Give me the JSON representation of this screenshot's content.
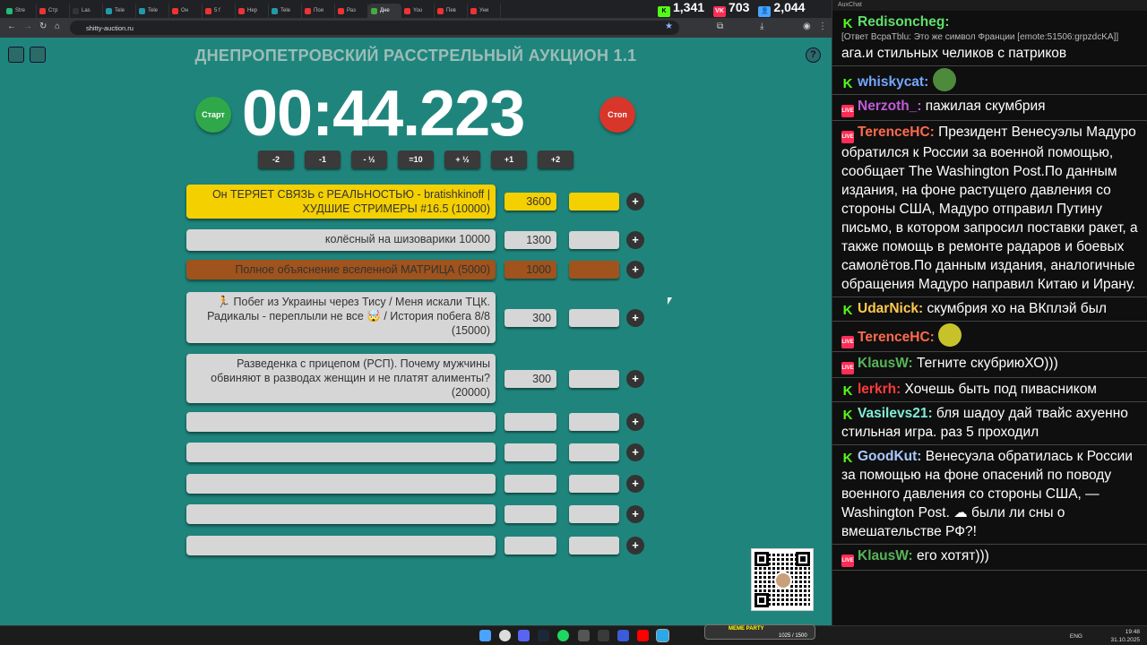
{
  "browser": {
    "tabs": [
      {
        "label": "Stre",
        "color": "#2b7"
      },
      {
        "label": "Стр",
        "color": "#e33"
      },
      {
        "label": "Las",
        "color": "#333"
      },
      {
        "label": "Tele",
        "color": "#29a"
      },
      {
        "label": "Tele",
        "color": "#29a"
      },
      {
        "label": "Он",
        "color": "#e33"
      },
      {
        "label": "5 f",
        "color": "#e33"
      },
      {
        "label": "Нер",
        "color": "#e33"
      },
      {
        "label": "Tele",
        "color": "#29a"
      },
      {
        "label": "Пои",
        "color": "#e33"
      },
      {
        "label": "Раз",
        "color": "#e33"
      },
      {
        "label": "Дне",
        "color": "#4a4"
      },
      {
        "label": "You",
        "color": "#e33"
      },
      {
        "label": "Пев",
        "color": "#e33"
      },
      {
        "label": "Уни",
        "color": "#e33"
      }
    ],
    "url": "shitty-auction.ru",
    "window_controls": [
      "—",
      "☐",
      "✕"
    ]
  },
  "stream_stats": {
    "kick_viewers": "1,341",
    "vk_viewers": "703",
    "total_viewers": "2,044"
  },
  "auction": {
    "title": "ДНЕПРОПЕТРОВСКИЙ РАССТРЕЛЬНЫЙ АУКЦИОН 1.1",
    "help": "?",
    "timer": "00:44.223",
    "start_label": "Старт",
    "stop_label": "Стоп",
    "adjust_buttons": [
      "-2",
      "-1",
      "- ½",
      "=10",
      "+ ½",
      "+1",
      "+2"
    ],
    "plus": "+",
    "lots": [
      {
        "name": "Он ТЕРЯЕТ СВЯЗЬ с РЕАЛЬНОСТЬЮ - bratishkinoff | ХУДШИЕ СТРИМЕРЫ #16.5 (10000)",
        "amount": "3600",
        "color": "#f5d000"
      },
      {
        "name": "колёсный на шизоварики 10000",
        "amount": "1300",
        "color": "#d6d6d6"
      },
      {
        "name": "Полное объяснение вселенной МАТРИЦА (5000)",
        "amount": "1000",
        "color": "#a0531c"
      },
      {
        "name": "🏃 Побег из Украины через Тису / Меня искали ТЦК. Радикалы - переплыли не все 🤯 / История побега 8/8 (15000)",
        "amount": "300",
        "color": "#d6d6d6"
      },
      {
        "name": "Разведенка с прицепом (РСП). Почему мужчины обвиняют в разводах женщин и не платят алименты? (20000)",
        "amount": "300",
        "color": "#d6d6d6"
      },
      {
        "name": "",
        "amount": "",
        "color": "#d6d6d6"
      },
      {
        "name": "",
        "amount": "",
        "color": "#d6d6d6"
      },
      {
        "name": "",
        "amount": "",
        "color": "#d6d6d6"
      },
      {
        "name": "",
        "amount": "",
        "color": "#d6d6d6"
      },
      {
        "name": "",
        "amount": "",
        "color": "#d6d6d6"
      }
    ]
  },
  "chat": {
    "window_title": "AuxChat",
    "messages": [
      {
        "platform": "kick",
        "nick": "Redisoncheg:",
        "nick_color": "#60e06a",
        "reply": "[Ответ ВсраТblu: Это же символ Франции [emote:51506:grpzdcKA]]",
        "text": "ага.и стильных челиков с патриков"
      },
      {
        "platform": "kick",
        "nick": "whiskycat:",
        "nick_color": "#74a7ff",
        "text": "",
        "emote": "#4d8a3c"
      },
      {
        "platform": "vk",
        "nick": "Nerzoth_:",
        "nick_color": "#c05ad8",
        "text": " пажилая скумбрия"
      },
      {
        "platform": "vk",
        "nick": "TerenceHC:",
        "nick_color": "#ff6a4d",
        "text": " Президент Венесуэлы Мадуро обратился к России за военной помощью, сообщает The Washington Post.По данным издания, на фоне растущего давления со стороны США, Мадуро отправил Путину письмо, в котором запросил поставки ракет, а также помощь в ремонте радаров и боевых самолётов.По данным издания, аналогичные обращения Мадуро направил Китаю и Ирану."
      },
      {
        "platform": "kick",
        "nick": "UdarNick:",
        "nick_color": "#ffc94d",
        "text": " скумбрия хо на ВКплэй был"
      },
      {
        "platform": "vk",
        "nick": "TerenceHC:",
        "nick_color": "#ff6a4d",
        "text": "",
        "emote": "#c8c22a"
      },
      {
        "platform": "vk",
        "nick": "KlausW:",
        "nick_color": "#58b35a",
        "text": " Тегните скубриюХО)))"
      },
      {
        "platform": "kick",
        "nick": "lerkrh:",
        "nick_color": "#ff3c3c",
        "text": " Хочешь быть под пивасником"
      },
      {
        "platform": "kick",
        "nick": "Vasilevs21:",
        "nick_color": "#7ff0d8",
        "text": " бля шадоу дай твайс ахуенно стильная игра. раз 5 проходил"
      },
      {
        "platform": "kick",
        "nick": "GoodKut:",
        "nick_color": "#a9c8ff",
        "text": " Венесуэла обратилась к России за помощью на фоне опасений по поводу военного давления со стороны США, — Washington Post. ☁ были ли сны о вмешательстве РФ?!"
      },
      {
        "platform": "vk",
        "nick": "KlausW:",
        "nick_color": "#58b35a",
        "text": " его хотят)))"
      }
    ]
  },
  "taskbar": {
    "meme_widget": "MEME PARTY",
    "meme_progress": "1025 / 1500",
    "lang": "ENG",
    "time": "19:48",
    "date": "31.10.2025"
  }
}
